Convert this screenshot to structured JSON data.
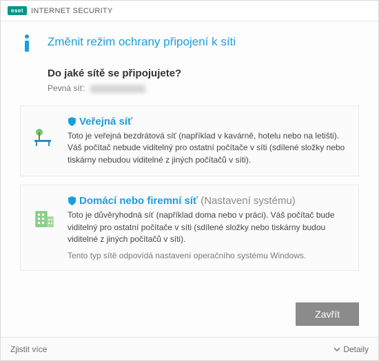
{
  "brand": {
    "badge": "eset",
    "name": "INTERNET SECURITY"
  },
  "heading": "Změnit režim ochrany připojení k síti",
  "question": "Do jaké sítě se připojujete?",
  "fixed_label": "Pevná síť:",
  "options": {
    "public": {
      "title": "Veřejná síť",
      "desc": "Toto je veřejná bezdrátová síť (například v kavárně, hotelu nebo na letišti). Váš počítač nebude viditelný pro ostatní počítače v síti (sdílené složky nebo tiskárny nebudou viditelné z jiných počítačů v síti)."
    },
    "private": {
      "title": "Domácí nebo firemní síť",
      "suffix": "(Nastavení systému)",
      "desc": "Toto je důvěryhodná síť (například doma nebo v práci). Váš počítač bude viditelný pro ostatní počítače v síti (sdílené složky nebo tiskárny budou viditelné z jiných počítačů v síti).",
      "note": "Tento typ sítě odpovídá nastavení operačního systému Windows."
    }
  },
  "buttons": {
    "close": "Zavřít"
  },
  "footer": {
    "learn_more": "Zjistit více",
    "details": "Detaily"
  }
}
